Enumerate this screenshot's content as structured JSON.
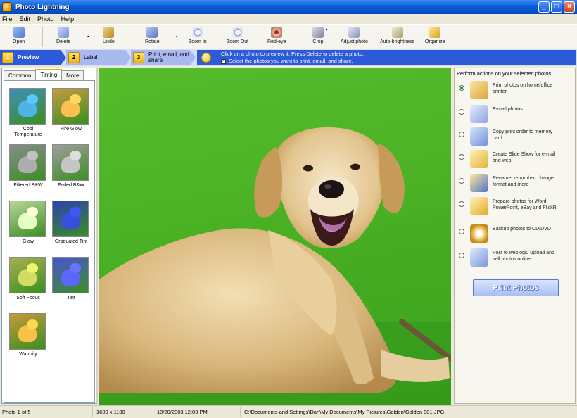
{
  "window": {
    "title": "Photo Lightning",
    "buttons": {
      "minimize": "_",
      "maximize": "□",
      "close": "×"
    }
  },
  "menu": [
    "File",
    "Edit",
    "Photo",
    "Help"
  ],
  "toolbar": [
    {
      "label": "Open",
      "icon": "open-icon"
    },
    {
      "label": "Delete",
      "icon": "delete-icon"
    },
    {
      "label": "Undo",
      "icon": "undo-icon"
    },
    {
      "label": "Rotate",
      "icon": "rotate-icon"
    },
    {
      "label": "Zoom In",
      "icon": "zoom-in-icon"
    },
    {
      "label": "Zoom Out",
      "icon": "zoom-out-icon"
    },
    {
      "label": "Red-eye",
      "icon": "red-eye-icon"
    },
    {
      "label": "Crop",
      "icon": "crop-icon"
    },
    {
      "label": "Adjust photo",
      "icon": "adjust-photo-icon"
    },
    {
      "label": "Auto-brightness",
      "icon": "auto-brightness-icon"
    },
    {
      "label": "Organize",
      "icon": "organize-icon"
    }
  ],
  "steps": [
    {
      "num": "1",
      "label": "Preview"
    },
    {
      "num": "2",
      "label": "Label"
    },
    {
      "num": "3",
      "label": "Print, email, and share"
    }
  ],
  "hint": {
    "line1": "Click on a photo to preview it.  Press Delete to delete a photo.",
    "line2": "Select the photos you want to print, email, and share.",
    "check": "✓"
  },
  "left_tabs": [
    "Common",
    "Tinting",
    "More"
  ],
  "effects": [
    {
      "label": "Cool Temperature",
      "color": "#3f8fb8"
    },
    {
      "label": "Fire Glow",
      "color": "#c89a40"
    },
    {
      "label": "Filtered B&W",
      "color": "#8a8a8a"
    },
    {
      "label": "Faded B&W",
      "color": "#9e9e9e"
    },
    {
      "label": "Glow",
      "color": "#b9d49a"
    },
    {
      "label": "Graduated Tint",
      "color": "#2d3fb0"
    },
    {
      "label": "Soft Focus",
      "color": "#a8b050"
    },
    {
      "label": "Tint",
      "color": "#4a52d8"
    },
    {
      "label": "Warmify",
      "color": "#c79a3a"
    }
  ],
  "right_panel": {
    "header": "Perform actions on your selected photos:",
    "actions": [
      {
        "label": "Print photos on home/office printer",
        "icon": "printer-icon",
        "selected": true
      },
      {
        "label": "E-mail photos",
        "icon": "email-icon",
        "selected": false
      },
      {
        "label": "Copy print order to memory card",
        "icon": "memory-card-icon",
        "selected": false
      },
      {
        "label": "Create Slide Show for e-mail and web",
        "icon": "slideshow-icon",
        "selected": false
      },
      {
        "label": "Rename, renumber, change format and more",
        "icon": "rename-icon",
        "selected": false
      },
      {
        "label": "Prepare photos for Word, PowerPoint, eBay and FlickR",
        "icon": "prepare-icon",
        "selected": false
      },
      {
        "label": "Backup photos to CD/DVD",
        "icon": "cd-icon",
        "selected": false
      },
      {
        "label": "Post to weblogs/ upload and sell photos online",
        "icon": "upload-icon",
        "selected": false
      }
    ],
    "print_button": "Print Photos"
  },
  "status": {
    "photo": "Photo 1 of 5",
    "dims": "1600 x 1100",
    "date": "10/20/2003  12:03 PM",
    "path": "C:\\Documents and Settings\\Dan\\My Documents\\My Pictures\\Golden\\Golden 001.JPG"
  },
  "colors": {
    "accent": "#2c5ad8",
    "title_bar": "#0a5fd6",
    "step_inactive": "#a7b9ee",
    "grass": "#48b023"
  }
}
